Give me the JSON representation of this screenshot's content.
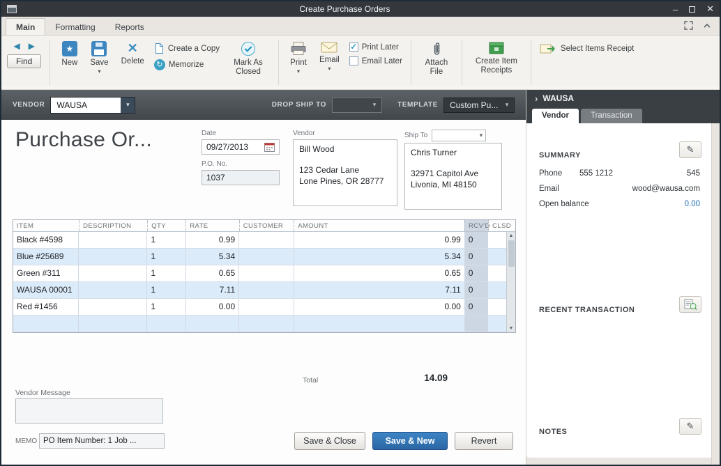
{
  "window": {
    "title": "Create Purchase Orders"
  },
  "icons": {
    "minimize": "–",
    "close": "✕",
    "caret_down": "▾",
    "back": "◀",
    "forward": "▶",
    "check": "✓",
    "pencil": "✎",
    "delete_x": "✕",
    "star": "★",
    "memorize": "↻",
    "chevron_right": "›",
    "up_arrow": "▲",
    "down_arrow": "▼"
  },
  "ribbon": {
    "tabs": [
      "Main",
      "Formatting",
      "Reports"
    ]
  },
  "toolbar": {
    "find": "Find",
    "new": "New",
    "save": "Save",
    "delete": "Delete",
    "create_copy": "Create a Copy",
    "memorize": "Memorize",
    "mark_closed": "Mark As Closed",
    "print": "Print",
    "email": "Email",
    "print_later": "Print Later",
    "print_later_checked": true,
    "email_later": "Email Later",
    "email_later_checked": false,
    "attach_file": "Attach File",
    "create_item_receipts": "Create Item Receipts",
    "select_items_receipt": "Select Items Receipt"
  },
  "vendor_bar": {
    "vendor_label": "VENDOR",
    "vendor_value": "WAUSA",
    "drop_ship_label": "DROP SHIP TO",
    "drop_ship_value": "",
    "template_label": "TEMPLATE",
    "template_value": "Custom Pu..."
  },
  "form": {
    "title": "Purchase Or...",
    "date_label": "Date",
    "date_value": "09/27/2013",
    "po_label": "P.O. No.",
    "po_value": "1037",
    "vendor_label": "Vendor",
    "vendor_name": "Bill Wood",
    "vendor_address1": "123 Cedar Lane",
    "vendor_address2": "Lone Pines, OR 28777",
    "ship_label": "Ship To",
    "ship_name": "Chris Turner",
    "ship_address1": "32971 Capitol Ave",
    "ship_address2": "Livonia, MI 48150"
  },
  "table": {
    "columns": [
      "ITEM",
      "DESCRIPTION",
      "QTY",
      "RATE",
      "CUSTOMER",
      "AMOUNT",
      "RCV'D",
      "CLSD"
    ],
    "rows": [
      {
        "item": "Black #4598",
        "description": "",
        "qty": "1",
        "rate": "0.99",
        "customer": "",
        "amount": "0.99",
        "rcvd": "0",
        "clsd": ""
      },
      {
        "item": "Blue #25689",
        "description": "",
        "qty": "1",
        "rate": "5.34",
        "customer": "",
        "amount": "5.34",
        "rcvd": "0",
        "clsd": ""
      },
      {
        "item": "Green #311",
        "description": "",
        "qty": "1",
        "rate": "0.65",
        "customer": "",
        "amount": "0.65",
        "rcvd": "0",
        "clsd": ""
      },
      {
        "item": "WAUSA 00001",
        "description": "",
        "qty": "1",
        "rate": "7.11",
        "customer": "",
        "amount": "7.11",
        "rcvd": "0",
        "clsd": ""
      },
      {
        "item": "Red #1456",
        "description": "",
        "qty": "1",
        "rate": "0.00",
        "customer": "",
        "amount": "0.00",
        "rcvd": "0",
        "clsd": ""
      },
      {
        "item": "",
        "description": "",
        "qty": "",
        "rate": "",
        "customer": "",
        "amount": "",
        "rcvd": "",
        "clsd": ""
      }
    ]
  },
  "totals": {
    "total_label": "Total",
    "total_value": "14.09"
  },
  "footer": {
    "vendor_message_label": "Vendor Message",
    "memo_label": "MEMO",
    "memo_value": "PO Item Number: 1 Job ...",
    "save_close": "Save & Close",
    "save_new": "Save & New",
    "revert": "Revert"
  },
  "sidebar": {
    "header_title": "WAUSA",
    "tabs": [
      "Vendor",
      "Transaction"
    ],
    "summary_label": "SUMMARY",
    "phone_label": "Phone",
    "phone_value": "555 1212",
    "phone_right": "545",
    "email_label": "Email",
    "email_value": "wood@wausa.com",
    "open_balance_label": "Open balance",
    "open_balance_value": "0.00",
    "recent_transaction_label": "RECENT TRANSACTION",
    "notes_label": "NOTES"
  },
  "colors": {
    "accent_blue": "#2a66a3",
    "link_blue": "#1f6fb5",
    "row_alt_blue": "#dcebf9",
    "dark_gray": "#3a3f44",
    "green": "#3f9e4d"
  }
}
